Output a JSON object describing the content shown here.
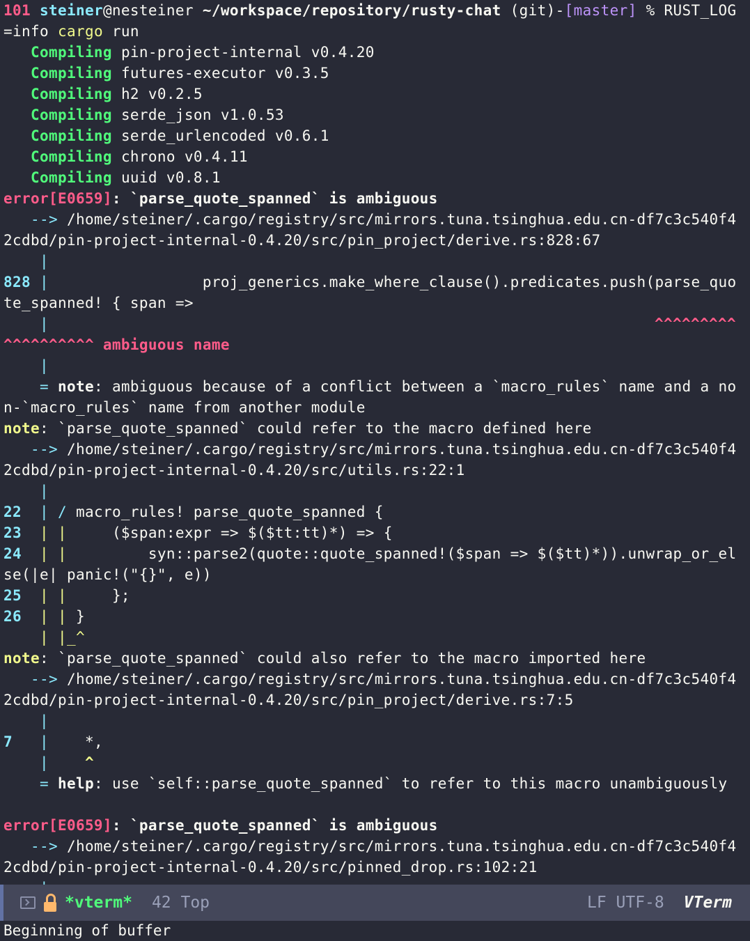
{
  "prompt": {
    "count": "101",
    "user": "steiner",
    "host": "@nesteiner",
    "path": "~/workspace/repository/rusty-chat",
    "git_open": "(git)-",
    "branch": "[master]",
    "tail": " % RUST_LOG",
    "wrap_pre": "=info ",
    "cmd": "cargo",
    "cmd_rest": " run"
  },
  "compiling_word": "Compiling",
  "compiling": [
    "pin-project-internal v0.4.20",
    "futures-executor v0.3.5",
    "h2 v0.2.5",
    "serde_json v1.0.53",
    "serde_urlencoded v0.6.1",
    "chrono v0.4.11",
    "uuid v0.8.1"
  ],
  "err1": {
    "label": "error[E0659]",
    "msg": ": `parse_quote_spanned` is ambiguous",
    "arrow": "   --> ",
    "path1": "/home/steiner/.cargo/registry/src/mirrors.tuna.tsinghua.edu.cn-df7c3c540f4",
    "path2": "2cdbd/pin-project-internal-0.4.20/src/pin_project/derive.rs:828:67",
    "lineno": "828",
    "code1": "                 proj_generics.make_where_clause().predicates.push(parse_quo",
    "code2": "te_spanned! { span =>",
    "carets1": "^^^^^^^^^",
    "carets2": "^^^^^^^^^^",
    "ambig": " ambiguous name",
    "eq": "    = ",
    "note_word": "note",
    "note_msg": ": ambiguous because of a conflict between a `macro_rules` name and a no",
    "note_msg2": "n-`macro_rules` name from another module"
  },
  "note1": {
    "label": "note",
    "msg": ": `parse_quote_spanned` could refer to the macro defined here",
    "path2": "2cdbd/pin-project-internal-0.4.20/src/utils.rs:22:1",
    "lines": [
      {
        "n": "22",
        "bar": "  | / ",
        "code": "macro_rules! parse_quote_spanned {"
      },
      {
        "n": "23",
        "bar": "  | |     ",
        "code": "($span:expr => $($tt:tt)*) => {"
      },
      {
        "n": "24",
        "bar": "  | |         ",
        "code": "syn::parse2(quote::quote_spanned!($span => $($tt)*)).unwrap_or_el"
      },
      {
        "n": "",
        "bar": "",
        "code": "se(|e| panic!(\"{}\", e))"
      },
      {
        "n": "25",
        "bar": "  | |     ",
        "code": "};"
      },
      {
        "n": "26",
        "bar": "  | | ",
        "code": "}"
      }
    ],
    "end": "    | |_^"
  },
  "note2": {
    "label": "note",
    "msg": ": `parse_quote_spanned` could also refer to the macro imported here",
    "path2": "2cdbd/pin-project-internal-0.4.20/src/pin_project/derive.rs:7:5",
    "lineno": "7",
    "code": "    *,",
    "caret": "^",
    "help_word": "help",
    "help_msg": ": use `self::parse_quote_spanned` to refer to this macro unambiguously"
  },
  "err2": {
    "label": "error[E0659]",
    "msg": ": `parse_quote_spanned` is ambiguous",
    "path2": "2cdbd/pin-project-internal-0.4.20/src/pinned_drop.rs:102:21"
  },
  "modeline": {
    "buffer": "*vterm*",
    "position": "42 Top",
    "encoding": "LF UTF-8",
    "mode": "VTerm"
  },
  "echo": "Beginning of buffer"
}
